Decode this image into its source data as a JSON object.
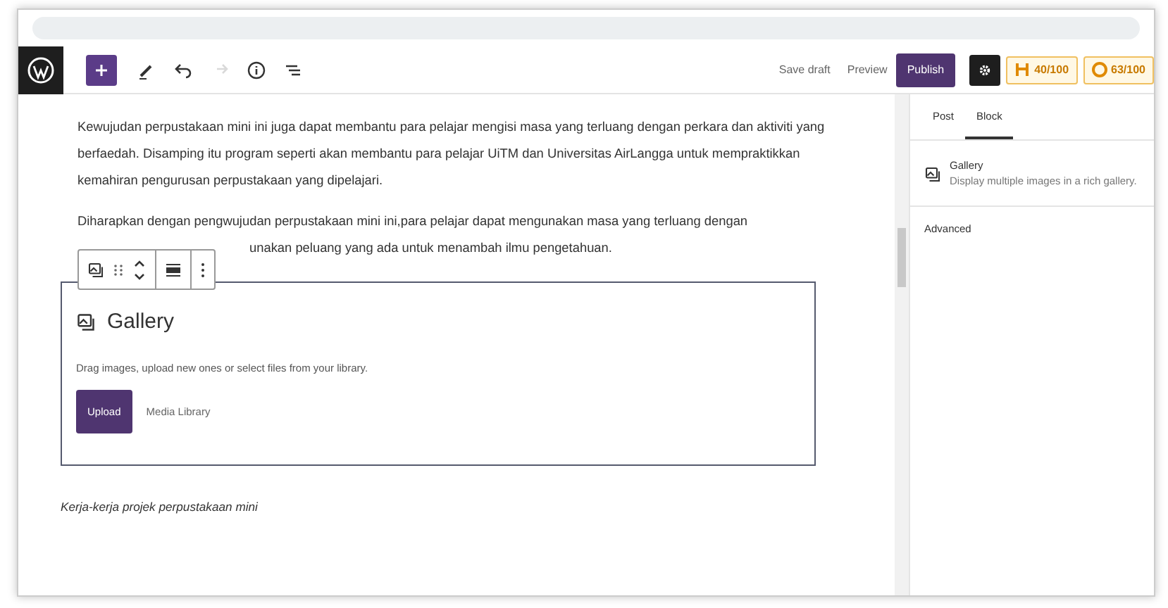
{
  "toolbar": {
    "buttons": [
      {
        "kind": "add",
        "disabled": false
      },
      {
        "kind": "edit",
        "disabled": false
      },
      {
        "kind": "undo",
        "disabled": false
      },
      {
        "kind": "redo",
        "disabled": true
      },
      {
        "kind": "info",
        "disabled": false
      },
      {
        "kind": "outline",
        "disabled": false
      }
    ],
    "save_draft": "Save draft",
    "preview": "Preview",
    "publish": "Publish",
    "scores": [
      {
        "kind": "seo",
        "value": "40/100"
      },
      {
        "kind": "readability",
        "value": "63/100"
      }
    ]
  },
  "content": {
    "paragraphs": [
      "Kewujudan perpustakaan mini ini juga dapat membantu para pelajar mengisi masa yang terluang dengan perkara dan aktiviti yang berfaedah. Disamping itu program seperti akan membantu para pelajar UiTM dan Universitas AirLangga untuk mempraktikkan kemahiran pengurusan perpustakaan yang dipelajari.",
      "Diharapkan dengan pengwujudan perpustakaan mini ini,para pelajar dapat mengunakan masa yang terluang dengan",
      "unakan peluang yang ada untuk menambah ilmu pengetahuan."
    ],
    "gallery": {
      "title": "Gallery",
      "instructions": "Drag images, upload new ones or select files from your library.",
      "upload": "Upload",
      "media_library": "Media Library"
    },
    "caption": "Kerja-kerja projek perpustakaan mini"
  },
  "sidebar": {
    "tabs": [
      {
        "label": "Post",
        "selected": false
      },
      {
        "label": "Block",
        "selected": true
      }
    ],
    "block": {
      "name": "Gallery",
      "description": "Display multiple images in a rich gallery."
    },
    "panels": [
      {
        "label": "Advanced",
        "expanded": false
      }
    ]
  }
}
